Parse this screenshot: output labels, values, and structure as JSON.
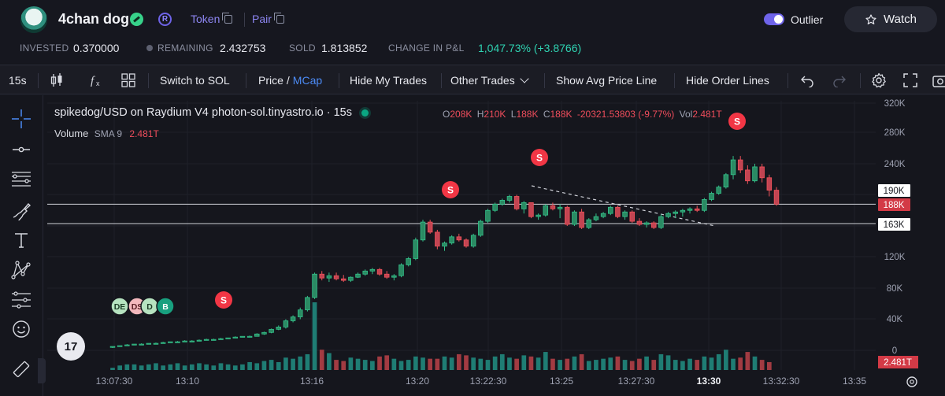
{
  "header": {
    "token_name": "4chan dog",
    "token_link": "Token",
    "pair_link": "Pair",
    "outlier_label": "Outlier",
    "watch_label": "Watch",
    "badge_r": "R"
  },
  "stats": [
    {
      "label": "INVESTED",
      "value": "0.370000"
    },
    {
      "label": "REMAINING",
      "value": "2.432753"
    },
    {
      "label": "SOLD",
      "value": "1.813852"
    },
    {
      "label": "CHANGE IN P&L",
      "value": "1,047.73% (+3.8766)"
    }
  ],
  "toolbar": {
    "interval": "15s",
    "switch": "Switch to SOL",
    "price": "Price",
    "slash": "/",
    "mcap": "MCap",
    "hide_my_trades": "Hide My Trades",
    "other_trades": "Other Trades",
    "avg_price": "Show Avg Price Line",
    "hide_order_lines": "Hide Order Lines"
  },
  "chart_header": {
    "symbol": "spikedog/USD on Raydium V4 photon-sol.tinyastro.io · 15s",
    "o_label": "O",
    "o": "208K",
    "h_label": "H",
    "h": "210K",
    "l_label": "L",
    "l": "188K",
    "c_label": "C",
    "c": "188K",
    "change": "-20321.53803 (-9.77%)",
    "vol_label": "Vol",
    "vol": "2.481T",
    "volume_name": "Volume",
    "volume_sma": "SMA 9",
    "volume_value": "2.481T",
    "tv_logo": "17"
  },
  "colors": {
    "up": "#26a69a",
    "down": "#ef5350",
    "sell_marker": "#f23645",
    "accent": "#6f64ea"
  },
  "chart_data": {
    "type": "candlestick",
    "x_ticks": [
      "13:07:30",
      "13:10",
      "13:16",
      "13:20",
      "13:22:30",
      "13:25",
      "13:27:30",
      "13:30",
      "13:32:30",
      "13:35"
    ],
    "x_tick_bold": "13:30",
    "y_ticks": [
      "320K",
      "280K",
      "240K",
      "120K",
      "80K",
      "40K",
      "0"
    ],
    "ylim": [
      0,
      320000
    ],
    "price_labels": [
      "190K",
      "188K",
      "163K"
    ],
    "volume_label": "2.481T",
    "horizontal_lines": [
      188000,
      163000
    ],
    "candles": [
      [
        4,
        5,
        3,
        5
      ],
      [
        5,
        6,
        5,
        6
      ],
      [
        6,
        8,
        6,
        7
      ],
      [
        7,
        8,
        7,
        8
      ],
      [
        8,
        9,
        7,
        8
      ],
      [
        8,
        9,
        8,
        9
      ],
      [
        9,
        10,
        8,
        9
      ],
      [
        9,
        11,
        9,
        10
      ],
      [
        10,
        11,
        10,
        11
      ],
      [
        11,
        12,
        10,
        11
      ],
      [
        11,
        13,
        11,
        12
      ],
      [
        12,
        13,
        11,
        12
      ],
      [
        12,
        14,
        12,
        13
      ],
      [
        13,
        15,
        13,
        14
      ],
      [
        14,
        15,
        13,
        14
      ],
      [
        14,
        16,
        14,
        15
      ],
      [
        15,
        16,
        15,
        16
      ],
      [
        16,
        18,
        16,
        17
      ],
      [
        17,
        18,
        17,
        18
      ],
      [
        18,
        19,
        17,
        18
      ],
      [
        18,
        22,
        18,
        21
      ],
      [
        21,
        24,
        20,
        23
      ],
      [
        23,
        28,
        22,
        27
      ],
      [
        27,
        32,
        26,
        30
      ],
      [
        30,
        40,
        28,
        38
      ],
      [
        38,
        45,
        36,
        43
      ],
      [
        43,
        55,
        40,
        52
      ],
      [
        52,
        70,
        50,
        68
      ],
      [
        68,
        100,
        66,
        98
      ],
      [
        98,
        102,
        90,
        93
      ],
      [
        93,
        100,
        88,
        96
      ],
      [
        96,
        100,
        90,
        92
      ],
      [
        92,
        97,
        88,
        90
      ],
      [
        90,
        95,
        88,
        94
      ],
      [
        94,
        100,
        93,
        98
      ],
      [
        98,
        104,
        96,
        102
      ],
      [
        102,
        106,
        98,
        104
      ],
      [
        104,
        106,
        96,
        98
      ],
      [
        98,
        102,
        92,
        94
      ],
      [
        94,
        98,
        90,
        96
      ],
      [
        96,
        112,
        94,
        110
      ],
      [
        110,
        120,
        108,
        118
      ],
      [
        118,
        145,
        116,
        142
      ],
      [
        142,
        168,
        140,
        165
      ],
      [
        165,
        168,
        150,
        152
      ],
      [
        152,
        155,
        130,
        134
      ],
      [
        134,
        140,
        128,
        138
      ],
      [
        138,
        148,
        136,
        146
      ],
      [
        146,
        150,
        140,
        142
      ],
      [
        142,
        144,
        132,
        134
      ],
      [
        134,
        150,
        132,
        148
      ],
      [
        148,
        168,
        146,
        166
      ],
      [
        166,
        182,
        164,
        180
      ],
      [
        180,
        190,
        178,
        188
      ],
      [
        188,
        195,
        186,
        193
      ],
      [
        193,
        200,
        190,
        198
      ],
      [
        198,
        200,
        180,
        182
      ],
      [
        182,
        192,
        176,
        190
      ],
      [
        190,
        190,
        170,
        172
      ],
      [
        172,
        176,
        168,
        174
      ],
      [
        174,
        188,
        172,
        186
      ],
      [
        186,
        190,
        180,
        182
      ],
      [
        182,
        188,
        170,
        184
      ],
      [
        184,
        186,
        160,
        162
      ],
      [
        162,
        180,
        160,
        178
      ],
      [
        178,
        182,
        156,
        158
      ],
      [
        158,
        170,
        156,
        168
      ],
      [
        168,
        176,
        166,
        172
      ],
      [
        172,
        178,
        170,
        176
      ],
      [
        176,
        186,
        174,
        184
      ],
      [
        184,
        186,
        170,
        172
      ],
      [
        172,
        180,
        168,
        178
      ],
      [
        178,
        180,
        164,
        166
      ],
      [
        166,
        170,
        160,
        162
      ],
      [
        162,
        166,
        158,
        164
      ],
      [
        164,
        166,
        156,
        158
      ],
      [
        158,
        175,
        156,
        172
      ],
      [
        172,
        178,
        170,
        176
      ],
      [
        176,
        180,
        170,
        178
      ],
      [
        178,
        182,
        172,
        180
      ],
      [
        180,
        184,
        176,
        182
      ],
      [
        182,
        186,
        178,
        180
      ],
      [
        180,
        196,
        178,
        194
      ],
      [
        194,
        204,
        192,
        202
      ],
      [
        202,
        212,
        200,
        210
      ],
      [
        210,
        228,
        208,
        226
      ],
      [
        226,
        250,
        220,
        245
      ],
      [
        245,
        250,
        228,
        232
      ],
      [
        232,
        238,
        214,
        218
      ],
      [
        218,
        240,
        216,
        236
      ],
      [
        236,
        240,
        216,
        222
      ],
      [
        222,
        226,
        198,
        206
      ],
      [
        206,
        210,
        186,
        188
      ]
    ],
    "volumes": [
      2,
      4,
      5,
      5,
      4,
      5,
      6,
      4,
      5,
      6,
      4,
      5,
      6,
      5,
      4,
      6,
      5,
      4,
      5,
      7,
      6,
      8,
      9,
      7,
      11,
      10,
      12,
      14,
      60,
      18,
      15,
      9,
      8,
      11,
      10,
      9,
      8,
      12,
      13,
      10,
      8,
      9,
      12,
      11,
      10,
      10,
      12,
      11,
      14,
      13,
      11,
      10,
      9,
      12,
      14,
      11,
      10,
      13,
      12,
      11,
      16,
      10,
      9,
      10,
      12,
      14,
      8,
      9,
      10,
      11,
      12,
      9,
      8,
      10,
      12,
      9,
      14,
      13,
      9,
      8,
      10,
      9,
      12,
      11,
      14,
      18,
      10,
      11,
      16,
      12,
      9,
      7
    ]
  },
  "markers": [
    {
      "label": "S"
    },
    {
      "label": "S"
    },
    {
      "label": "S"
    },
    {
      "label": "S"
    },
    {
      "label": "DE"
    },
    {
      "label": "DS"
    },
    {
      "label": "D"
    },
    {
      "label": "B"
    }
  ]
}
